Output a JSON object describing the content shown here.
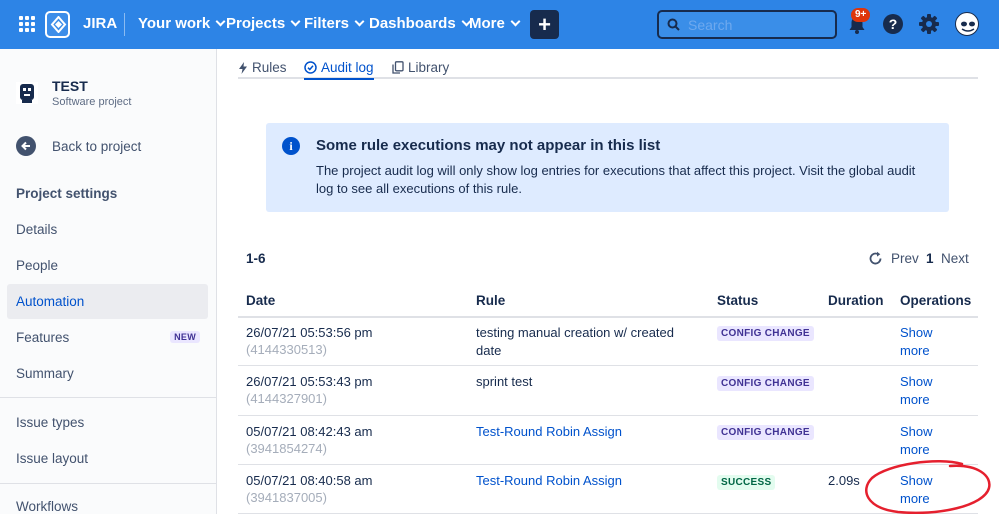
{
  "topnav": {
    "app_name": "JIRA",
    "menu": [
      {
        "label": "Your work"
      },
      {
        "label": "Projects"
      },
      {
        "label": "Filters"
      },
      {
        "label": "Dashboards"
      },
      {
        "label": "More"
      }
    ],
    "create_label": "+",
    "search_placeholder": "Search",
    "notification_badge": "9+",
    "help_label": "?",
    "icons": [
      "app-switcher-icon",
      "jira-logo-icon",
      "search-icon",
      "bell-icon",
      "help-icon",
      "gear-icon",
      "avatar"
    ],
    "brand_color": "#2d84e6"
  },
  "sidebar": {
    "project_name": "TEST",
    "project_type": "Software project",
    "back_label": "Back to project",
    "section_title": "Project settings",
    "items": [
      {
        "label": "Details"
      },
      {
        "label": "People"
      },
      {
        "label": "Automation",
        "active": true
      },
      {
        "label": "Features",
        "badge": "NEW"
      },
      {
        "label": "Summary"
      },
      {
        "label": "Issue types"
      },
      {
        "label": "Issue layout"
      },
      {
        "label": "Workflows"
      }
    ]
  },
  "tabs": [
    {
      "label": "Rules",
      "icon": "lightning-icon"
    },
    {
      "label": "Audit log",
      "icon": "check-circle-icon",
      "active": true
    },
    {
      "label": "Library",
      "icon": "copy-icon"
    }
  ],
  "banner": {
    "title": "Some rule executions may not appear in this list",
    "body": "The project audit log will only show log entries for executions that affect this project. Visit the global audit log to see all executions of this rule."
  },
  "pagination": {
    "range": "1-6",
    "prev": "Prev",
    "page": "1",
    "next": "Next"
  },
  "table": {
    "headers": [
      "Date",
      "Rule",
      "Status",
      "Duration",
      "Operations"
    ],
    "rows": [
      {
        "date": "26/07/21 05:53:56 pm",
        "id": "(4144330513)",
        "rule_line1": "testing manual creation w/ created",
        "rule_line2": "date",
        "rule_link": false,
        "status": "CONFIG CHANGE",
        "duration": "",
        "op_line1": "Show",
        "op_line2": "more"
      },
      {
        "date": "26/07/21 05:53:43 pm",
        "id": "(4144327901)",
        "rule_line1": "sprint test",
        "rule_line2": "",
        "rule_link": false,
        "status": "CONFIG CHANGE",
        "duration": "",
        "op_line1": "Show",
        "op_line2": "more"
      },
      {
        "date": "05/07/21 08:42:43 am",
        "id": "(3941854274)",
        "rule_line1": "Test-Round Robin Assign",
        "rule_line2": "",
        "rule_link": true,
        "status": "CONFIG CHANGE",
        "duration": "",
        "op_line1": "Show",
        "op_line2": "more"
      },
      {
        "date": "05/07/21 08:40:58 am",
        "id": "(3941837005)",
        "rule_line1": "Test-Round Robin Assign",
        "rule_line2": "",
        "rule_link": true,
        "status": "SUCCESS",
        "duration": "2.09s",
        "op_line1": "Show",
        "op_line2": "more"
      }
    ]
  },
  "colors": {
    "link": "#0052cc",
    "config_change_bg": "#eae6ff",
    "success_bg": "#e3fcef",
    "annotation": "#e5202e"
  }
}
